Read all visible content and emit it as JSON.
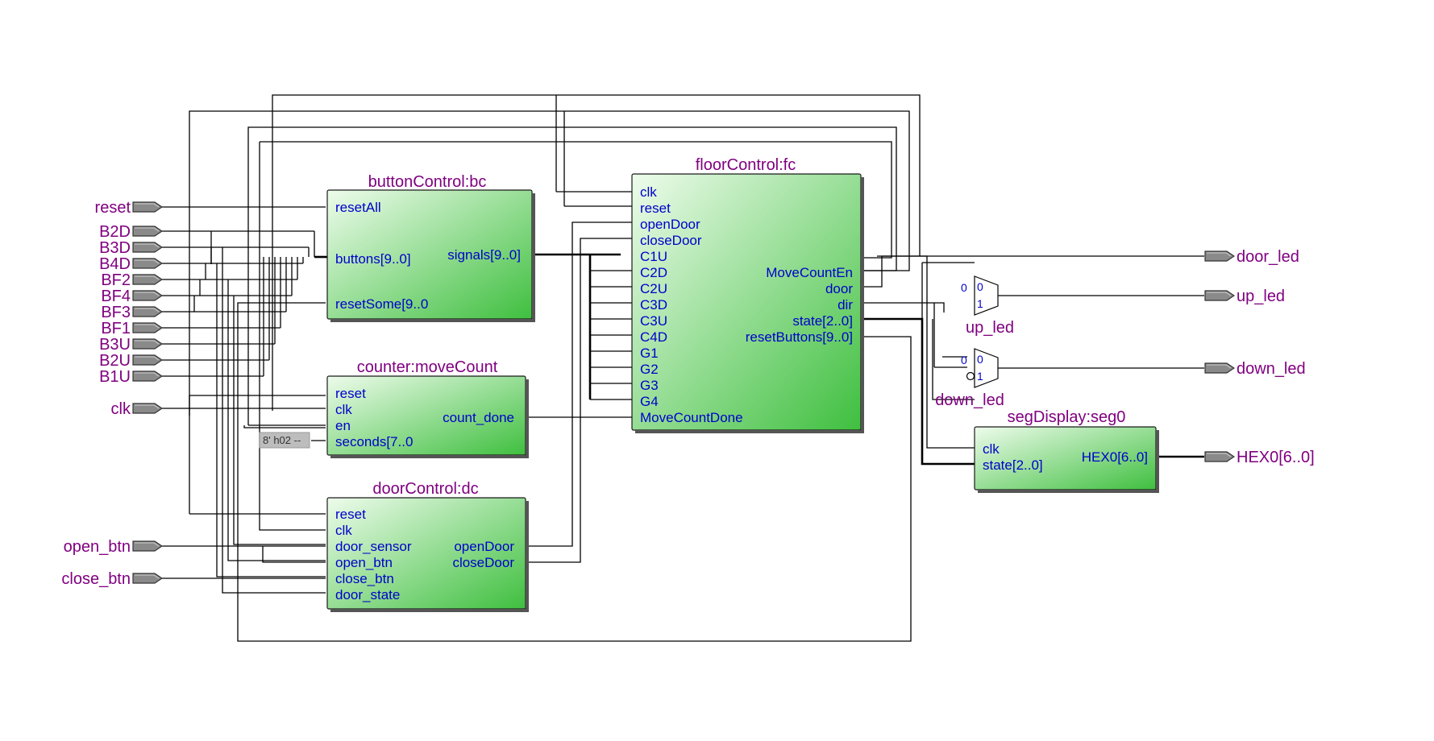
{
  "inputs": [
    {
      "id": "reset",
      "label": "reset"
    },
    {
      "id": "b2d",
      "label": "B2D"
    },
    {
      "id": "b3d",
      "label": "B3D"
    },
    {
      "id": "b4d",
      "label": "B4D"
    },
    {
      "id": "bf2",
      "label": "BF2"
    },
    {
      "id": "bf4",
      "label": "BF4"
    },
    {
      "id": "bf3",
      "label": "BF3"
    },
    {
      "id": "bf1",
      "label": "BF1"
    },
    {
      "id": "b3u",
      "label": "B3U"
    },
    {
      "id": "b2u",
      "label": "B2U"
    },
    {
      "id": "b1u",
      "label": "B1U"
    },
    {
      "id": "clk",
      "label": "clk"
    },
    {
      "id": "open-btn",
      "label": "open_btn"
    },
    {
      "id": "close-btn",
      "label": "close_btn"
    }
  ],
  "outputs": [
    {
      "id": "door-led",
      "label": "door_led"
    },
    {
      "id": "up-led",
      "label": "up_led"
    },
    {
      "id": "down-led",
      "label": "down_led"
    },
    {
      "id": "hex0",
      "label": "HEX0[6..0]"
    }
  ],
  "blocks": {
    "bc": {
      "title": "buttonControl:bc",
      "ports": {
        "resetAll": "resetAll",
        "buttons": "buttons[9..0]",
        "resetSome": "resetSome[9..0",
        "signals": "signals[9..0]"
      }
    },
    "mc": {
      "title": "counter:moveCount",
      "ports": {
        "reset": "reset",
        "clk": "clk",
        "en": "en",
        "seconds": "seconds[7..0",
        "done": "count_done"
      }
    },
    "dc": {
      "title": "doorControl:dc",
      "ports": {
        "reset": "reset",
        "clk": "clk",
        "door_sensor": "door_sensor",
        "open_btn": "open_btn",
        "close_btn": "close_btn",
        "door_state": "door_state",
        "openDoor": "openDoor",
        "closeDoor": "closeDoor"
      }
    },
    "fc": {
      "title": "floorControl:fc",
      "left_ports": [
        "clk",
        "reset",
        "openDoor",
        "closeDoor",
        "C1U",
        "C2D",
        "C2U",
        "C3D",
        "C3U",
        "C4D",
        "G1",
        "G2",
        "G3",
        "G4",
        "MoveCountDone"
      ],
      "right_ports": {
        "moveCountEn": "MoveCountEn",
        "door": "door",
        "dir": "dir",
        "state": "state[2..0]",
        "resetButtons": "resetButtons[9..0]"
      }
    },
    "seg": {
      "title": "segDisplay:seg0",
      "ports": {
        "clk": "clk",
        "state": "state[2..0]",
        "hex": "HEX0[6..0]"
      }
    }
  },
  "muxes": {
    "up": {
      "label": "up_led",
      "in0": "0",
      "in1": "1",
      "const0": "0"
    },
    "down": {
      "label": "down_led",
      "in0": "0",
      "in1": "1",
      "const0": "0"
    }
  },
  "constant": {
    "label": "8' h02 --"
  },
  "colors": {
    "block_light": "#eefcec",
    "block_dark": "#3fbf3f",
    "title": "#800080",
    "port_text": "#0000cc",
    "wire": "#000000",
    "pin_fill": "#8a8a8a"
  }
}
